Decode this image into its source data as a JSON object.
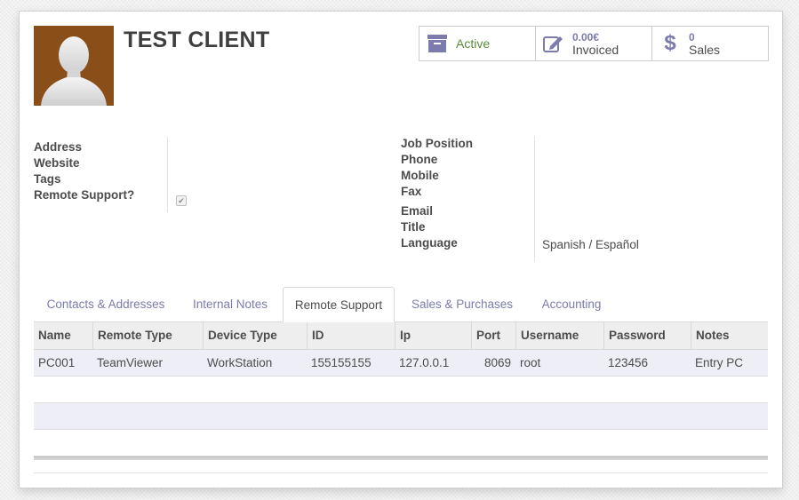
{
  "header": {
    "title": "TEST CLIENT"
  },
  "stats": {
    "active_label": "Active",
    "invoiced_value": "0.00€",
    "invoiced_label": "Invoiced",
    "sales_value": "0",
    "sales_label": "Sales"
  },
  "left_fields": {
    "address": "Address",
    "website": "Website",
    "tags": "Tags",
    "remote_support": "Remote Support?",
    "remote_support_checked": true
  },
  "right_fields": {
    "job_position": "Job Position",
    "phone": "Phone",
    "mobile": "Mobile",
    "fax": "Fax",
    "email": "Email",
    "title": "Title",
    "language": "Language",
    "language_value": "Spanish / Español"
  },
  "tabs": [
    {
      "label": "Contacts & Addresses",
      "active": false
    },
    {
      "label": "Internal Notes",
      "active": false
    },
    {
      "label": "Remote Support",
      "active": true
    },
    {
      "label": "Sales & Purchases",
      "active": false
    },
    {
      "label": "Accounting",
      "active": false
    }
  ],
  "table": {
    "columns": [
      "Name",
      "Remote Type",
      "Device Type",
      "ID",
      "Ip",
      "Port",
      "Username",
      "Password",
      "Notes"
    ],
    "rows": [
      [
        "PC001",
        "TeamViewer",
        "WorkStation",
        "155155155",
        "127.0.0.1",
        "8069",
        "root",
        "123456",
        "Entry PC"
      ]
    ]
  },
  "colors": {
    "accent": "#7c7bad",
    "active_green": "#5a8a3a",
    "avatar_bg": "#8a4f19",
    "row_highlight": "#eeeef6"
  },
  "icons": {
    "active": "archive-box-icon",
    "invoiced": "pencil-edit-icon",
    "sales": "dollar-icon"
  }
}
